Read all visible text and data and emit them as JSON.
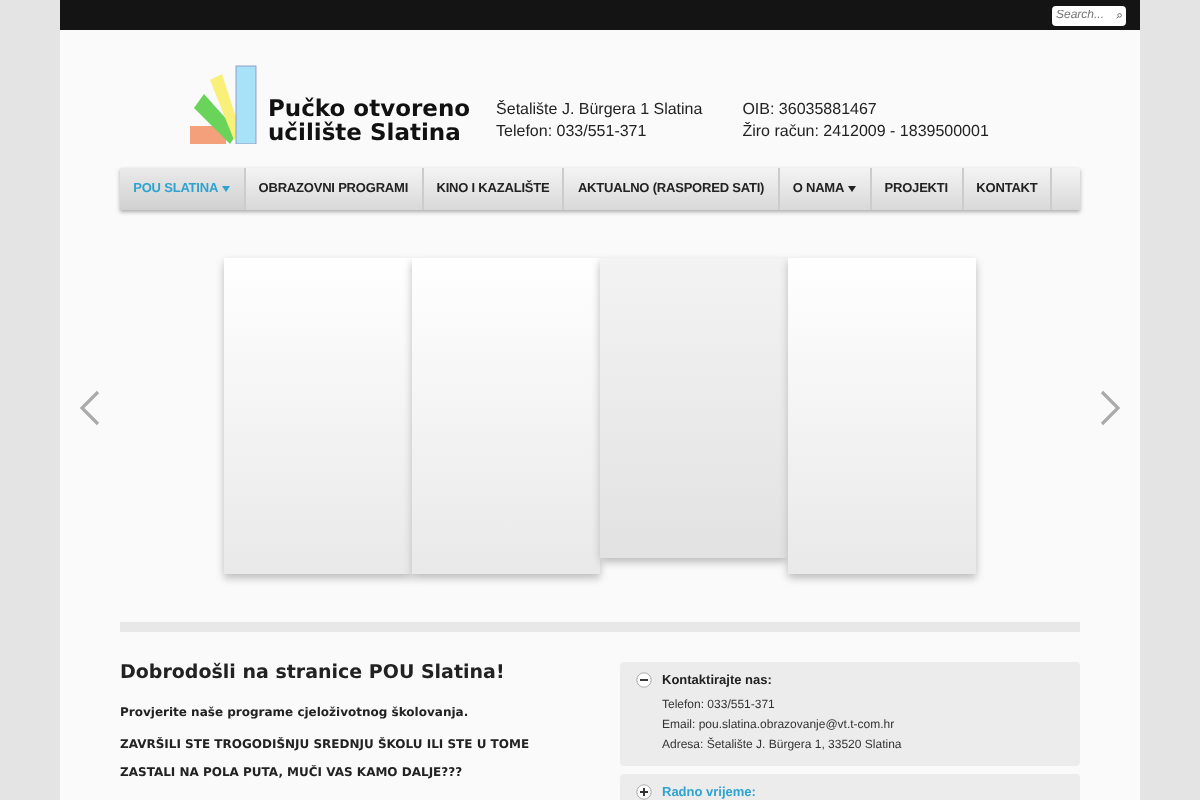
{
  "search": {
    "placeholder": "Search..."
  },
  "header": {
    "logo_text": [
      "Pučko otvoreno",
      "učilište Slatina"
    ],
    "address": [
      "Šetalište J. Bürgera 1 Slatina",
      "Telefon: 033/551-371"
    ],
    "ids": [
      "OIB: 36035881467",
      "Žiro račun: 2412009 - 1839500001"
    ]
  },
  "nav": [
    {
      "label": "POU SLATINA",
      "selected": true,
      "dropdown": true
    },
    {
      "label": "OBRAZOVNI PROGRAMI",
      "selected": false,
      "dropdown": false
    },
    {
      "label": "KINO I KAZALIŠTE",
      "selected": false,
      "dropdown": false
    },
    {
      "label": "AKTUALNO (RASPORED SATI)",
      "selected": false,
      "dropdown": false
    },
    {
      "label": "O NAMA",
      "selected": false,
      "dropdown": true
    },
    {
      "label": "PROJEKTI",
      "selected": false,
      "dropdown": false
    },
    {
      "label": "KONTAKT",
      "selected": false,
      "dropdown": false
    }
  ],
  "slides": [
    {
      "selected": false
    },
    {
      "selected": false
    },
    {
      "selected": true
    },
    {
      "selected": false
    }
  ],
  "content": {
    "heading": "Dobrodošli na stranice POU Slatina!",
    "paragraphs": [
      "Provjerite naše programe cjeloživotnog školovanja.",
      "ZAVRŠILI STE TROGODIŠNJU SREDNJU ŠKOLU ILI STE U TOME ZASTALI NA POLA PUTA, MUČI VAS KAMO DALJE???"
    ]
  },
  "accordion": [
    {
      "title": "Kontaktirajte nas:",
      "expanded": true,
      "lines": [
        "Telefon: 033/551-371",
        "Email: pou.slatina.obrazovanje@vt.t-com.hr",
        "Adresa: Šetalište J. Bürgera 1, 33520 Slatina"
      ]
    },
    {
      "title": "Radno vrijeme:",
      "expanded": false
    }
  ]
}
